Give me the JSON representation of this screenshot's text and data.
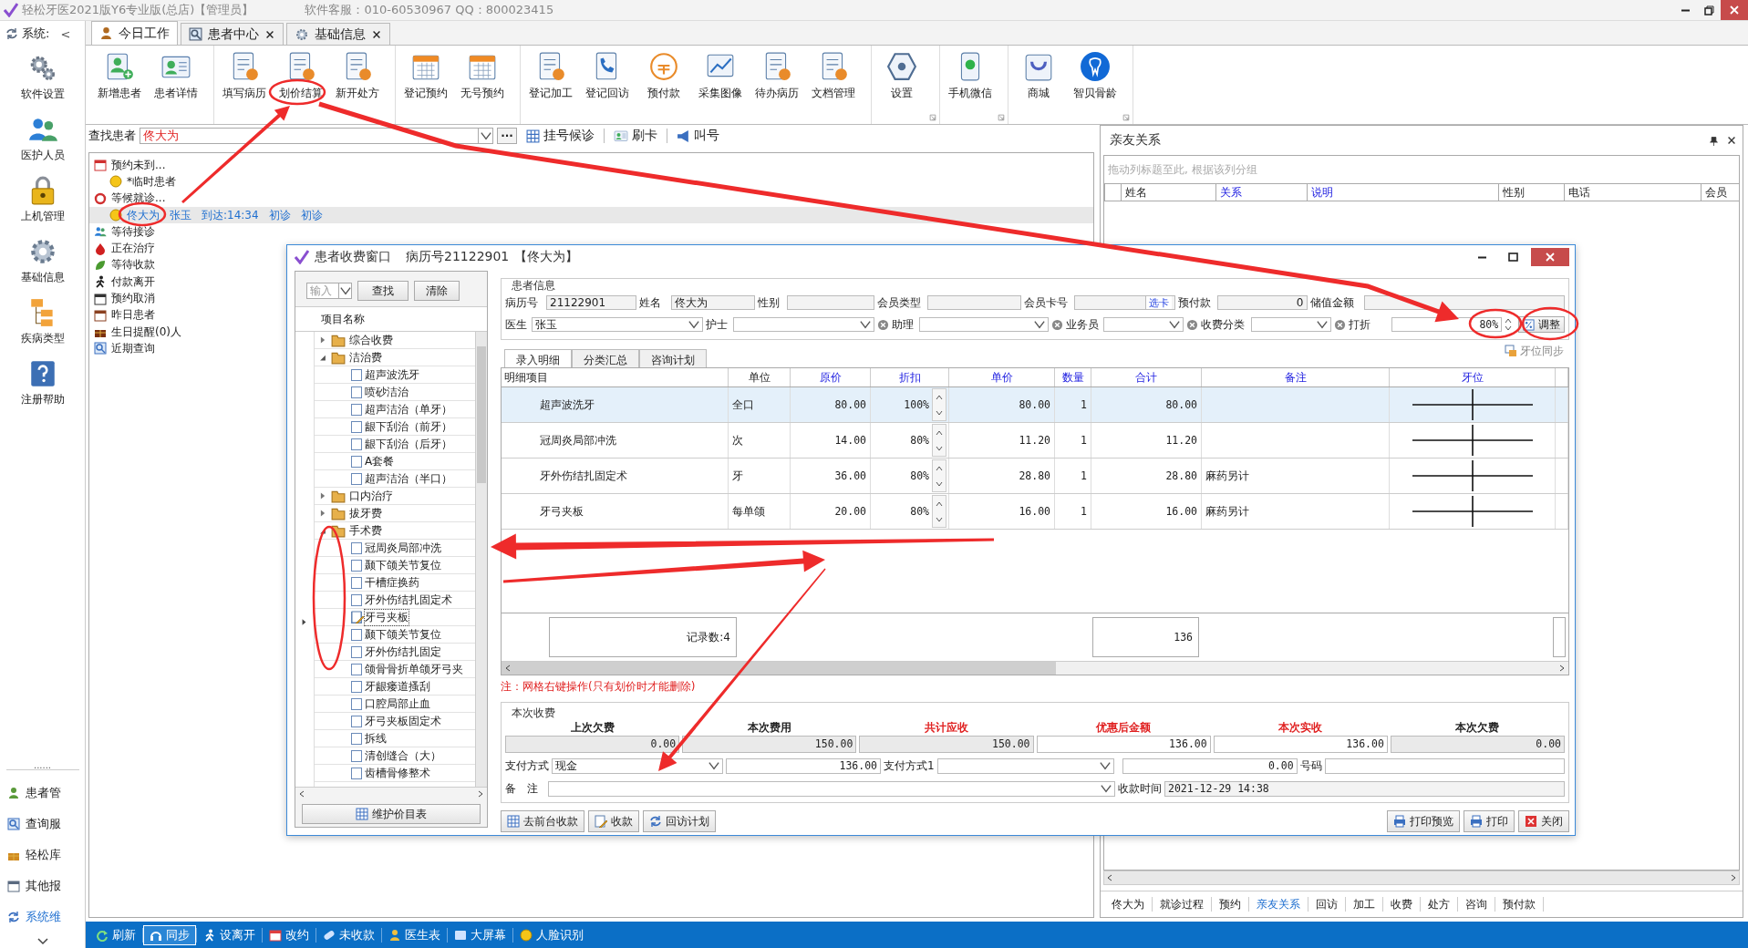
{
  "title_bar": {
    "title": "轻松牙医2021版Y6专业版(总店)【管理员】",
    "service": "软件客服：010-60530967 QQ：800023415"
  },
  "side_nav": {
    "header": "系统:",
    "collapse": "<",
    "items": [
      {
        "label": "软件设置"
      },
      {
        "label": "医护人员"
      },
      {
        "label": "上机管理"
      },
      {
        "label": "基础信息"
      },
      {
        "label": "疾病类型"
      },
      {
        "label": "注册帮助"
      }
    ],
    "divider": "......",
    "modules": [
      {
        "label": "患者管",
        "selected": false
      },
      {
        "label": "查询服",
        "selected": false
      },
      {
        "label": "轻松库",
        "selected": false
      },
      {
        "label": "其他报",
        "selected": false
      },
      {
        "label": "系统维",
        "selected": true
      }
    ]
  },
  "tabs": [
    {
      "label": "今日工作",
      "selected": true,
      "close": false
    },
    {
      "label": "患者中心",
      "selected": false,
      "close": true
    },
    {
      "label": "基础信息",
      "selected": false,
      "close": true
    }
  ],
  "ribbon": {
    "groups": [
      {
        "launcher": false,
        "buttons": [
          {
            "label": "新增患者"
          },
          {
            "label": "患者详情"
          }
        ]
      },
      {
        "launcher": false,
        "buttons": [
          {
            "label": "填写病历"
          },
          {
            "label": "划价结算"
          },
          {
            "label": "新开处方"
          }
        ]
      },
      {
        "launcher": false,
        "buttons": [
          {
            "label": "登记预约"
          },
          {
            "label": "无号预约"
          }
        ]
      },
      {
        "launcher": false,
        "buttons": [
          {
            "label": "登记加工"
          },
          {
            "label": "登记回访"
          },
          {
            "label": "预付款"
          },
          {
            "label": "采集图像"
          },
          {
            "label": "待办病历"
          },
          {
            "label": "文档管理"
          }
        ]
      },
      {
        "launcher": true,
        "buttons": [
          {
            "label": "设置"
          }
        ]
      },
      {
        "launcher": true,
        "buttons": [
          {
            "label": "手机微信"
          }
        ]
      },
      {
        "launcher": true,
        "buttons": [
          {
            "label": "商城"
          },
          {
            "label": "智贝骨龄"
          }
        ]
      }
    ]
  },
  "search": {
    "label": "查找患者",
    "value": "佟大为",
    "more": "···",
    "actions": [
      {
        "label": "挂号候诊"
      },
      {
        "label": "刷卡"
      },
      {
        "label": "叫号"
      }
    ]
  },
  "patient_list": {
    "items": [
      {
        "text": "预约未到...",
        "children": [
          {
            "cells": [
              "*临时患者"
            ],
            "selected": false
          }
        ]
      },
      {
        "text": "等候就诊...",
        "children": [
          {
            "cells": [
              "佟大为",
              "张玉",
              "到达:14:34",
              "初诊",
              "初诊"
            ],
            "selected": true
          }
        ]
      },
      {
        "text": "等待接诊"
      },
      {
        "text": "正在治疗"
      },
      {
        "text": "等待收款"
      },
      {
        "text": "付款离开"
      },
      {
        "text": "预约取消"
      },
      {
        "text": "昨日患者"
      },
      {
        "text": "生日提醒(0)人"
      },
      {
        "text": "近期查询"
      }
    ]
  },
  "relations_panel": {
    "title": "亲友关系",
    "group_hint": "拖动列标题至此, 根据该列分组",
    "columns": [
      {
        "label": "姓名",
        "highlight": false
      },
      {
        "label": "关系",
        "highlight": true
      },
      {
        "label": "说明",
        "highlight": true
      },
      {
        "label": "性别",
        "highlight": false
      },
      {
        "label": "电话",
        "highlight": false
      },
      {
        "label": "会员",
        "highlight": false
      }
    ],
    "tabs": [
      {
        "label": "佟大为",
        "selected": false
      },
      {
        "label": "就诊过程",
        "selected": false
      },
      {
        "label": "预约",
        "selected": false
      },
      {
        "label": "亲友关系",
        "selected": true
      },
      {
        "label": "回访",
        "selected": false
      },
      {
        "label": "加工",
        "selected": false
      },
      {
        "label": "收费",
        "selected": false
      },
      {
        "label": "处方",
        "selected": false
      },
      {
        "label": "咨询",
        "selected": false
      },
      {
        "label": "预付款",
        "selected": false
      }
    ]
  },
  "status_bar": [
    {
      "label": "刷新",
      "selected": false
    },
    {
      "label": "同步",
      "selected": true
    },
    {
      "label": "设离开",
      "selected": false
    },
    {
      "label": "改约",
      "selected": false
    },
    {
      "label": "未收款",
      "selected": false
    },
    {
      "label": "医生表",
      "selected": false
    },
    {
      "label": "大屏幕",
      "selected": false
    },
    {
      "label": "人脸识别",
      "selected": false
    }
  ],
  "charge_dialog": {
    "title": "患者收费窗口",
    "record": "病历号21122901",
    "patient": "【佟大为】",
    "search": {
      "placeholder": "输入",
      "find": "查找",
      "clear": "清除"
    },
    "tree_header": "项目名称",
    "tree": [
      {
        "label": "综合收费",
        "expanded": false
      },
      {
        "label": "洁治费",
        "expanded": true,
        "children": [
          {
            "label": "超声波洗牙",
            "checked": false,
            "current": false
          },
          {
            "label": "喷砂洁治",
            "checked": false,
            "current": false
          },
          {
            "label": "超声洁治（单牙）",
            "checked": false,
            "current": false
          },
          {
            "label": "龈下刮治（前牙）",
            "checked": false,
            "current": false
          },
          {
            "label": "龈下刮治（后牙）",
            "checked": false,
            "current": false
          },
          {
            "label": "A套餐",
            "checked": false,
            "current": false
          },
          {
            "label": "超声洁治（半口）",
            "checked": false,
            "current": false
          }
        ]
      },
      {
        "label": "口内治疗",
        "expanded": false
      },
      {
        "label": "拔牙费",
        "expanded": false
      },
      {
        "label": "手术费",
        "expanded": true,
        "children": [
          {
            "label": "冠周炎局部冲洗",
            "checked": false,
            "current": false
          },
          {
            "label": "颞下颌关节复位",
            "checked": false,
            "current": false
          },
          {
            "label": "干槽症换药",
            "checked": false,
            "current": false
          },
          {
            "label": "牙外伤结扎固定术",
            "checked": false,
            "current": false
          },
          {
            "label": "牙弓夹板",
            "checked": false,
            "current": true
          },
          {
            "label": "颞下颌关节复位",
            "checked": false,
            "current": false
          },
          {
            "label": "牙外伤结扎固定",
            "checked": false,
            "current": false
          },
          {
            "label": "颌骨骨折单颌牙弓夹",
            "checked": false,
            "current": false
          },
          {
            "label": "牙龈瘘道搔刮",
            "checked": false,
            "current": false
          },
          {
            "label": "口腔局部止血",
            "checked": false,
            "current": false
          },
          {
            "label": "牙弓夹板固定术",
            "checked": false,
            "current": false
          },
          {
            "label": "拆线",
            "checked": false,
            "current": false
          },
          {
            "label": "清创缝合（大）",
            "checked": false,
            "current": false
          },
          {
            "label": "齿槽骨修整术",
            "checked": false,
            "current": false
          }
        ]
      }
    ],
    "maintain_button": "维护价目表",
    "patient_info": {
      "title": "患者信息",
      "record_fields": [
        {
          "label": "病历号",
          "kind": "text",
          "value": "21122901"
        },
        {
          "label": "姓名",
          "kind": "text",
          "value": "佟大为"
        },
        {
          "label": "性别",
          "kind": "text"
        },
        {
          "label": "会员类型",
          "kind": "text"
        },
        {
          "label": "会员卡号",
          "kind": "card",
          "button": "选卡"
        },
        {
          "label": "预付款",
          "kind": "text",
          "value": "0"
        },
        {
          "label": "储值金额",
          "kind": "text"
        }
      ],
      "staff_fields": [
        {
          "label": "医生",
          "kind": "select",
          "value": "张玉",
          "clearable": false
        },
        {
          "label": "护士",
          "kind": "select",
          "clearable": true
        },
        {
          "label": "助理",
          "kind": "select",
          "clearable": true
        },
        {
          "label": "业务员",
          "kind": "select",
          "clearable": true
        },
        {
          "label": "收费分类",
          "kind": "select",
          "clearable": true
        },
        {
          "label": "打折",
          "kind": "spin",
          "value": "80%"
        }
      ],
      "adjust_button": "调整"
    },
    "sync_link": "牙位同步",
    "tabs": [
      {
        "label": "录入明细",
        "selected": true
      },
      {
        "label": "分类汇总",
        "selected": false
      },
      {
        "label": "咨询计划",
        "selected": false
      }
    ],
    "grid": {
      "columns": [
        {
          "label": "明细项目",
          "highlight": false
        },
        {
          "label": "单位",
          "highlight": false
        },
        {
          "label": "原价",
          "highlight": true
        },
        {
          "label": "折扣",
          "highlight": true
        },
        {
          "label": "单价",
          "highlight": true
        },
        {
          "label": "数量",
          "highlight": true
        },
        {
          "label": "合计",
          "highlight": true
        },
        {
          "label": "备注",
          "highlight": true
        },
        {
          "label": "牙位",
          "highlight": true
        }
      ],
      "rows": [
        {
          "item": "超声波洗牙",
          "unit": "全口",
          "price": "80.00",
          "discount": "100%",
          "unit_price": "80.00",
          "qty": "1",
          "total": "80.00",
          "selected": true
        },
        {
          "item": "冠周炎局部冲洗",
          "unit": "次",
          "price": "14.00",
          "discount": "80%",
          "unit_price": "11.20",
          "qty": "1",
          "total": "11.20",
          "selected": false
        },
        {
          "item": "牙外伤结扎固定术",
          "unit": "牙",
          "price": "36.00",
          "discount": "80%",
          "unit_price": "28.80",
          "qty": "1",
          "total": "28.80",
          "note": "麻药另计",
          "selected": false
        },
        {
          "item": "牙弓夹板",
          "unit": "每单颌",
          "price": "20.00",
          "discount": "80%",
          "unit_price": "16.00",
          "qty": "1",
          "total": "16.00",
          "note": "麻药另计",
          "selected": false
        }
      ],
      "footer": {
        "count": "记录数:4",
        "total": "136"
      }
    },
    "note": "注：网格右键操作(只有划价时才能删除)",
    "summary": {
      "title": "本次收费",
      "items": [
        {
          "label": "上次欠费",
          "emphasis": false,
          "value": "0.00",
          "editable": false
        },
        {
          "label": "本次费用",
          "emphasis": false,
          "value": "150.00",
          "editable": false
        },
        {
          "label": "共计应收",
          "emphasis": true,
          "value": "150.00",
          "editable": false
        },
        {
          "label": "优惠后金额",
          "emphasis": true,
          "value": "136.00",
          "editable": true
        },
        {
          "label": "本次实收",
          "emphasis": true,
          "value": "136.00",
          "editable": true
        },
        {
          "label": "本次欠费",
          "emphasis": false,
          "value": "0.00",
          "editable": false
        }
      ]
    },
    "payment": {
      "method_label": "支付方式",
      "method": "现金",
      "amount": "136.00",
      "method2_label": "支付方式1",
      "amount2": "0.00",
      "number_label": "号码"
    },
    "remark": {
      "label": "备　注",
      "time_label": "收款时间",
      "time": "2021-12-29 14:38"
    },
    "buttons_left": [
      {
        "label": "去前台收款"
      },
      {
        "label": "收款"
      },
      {
        "label": "回访计划"
      }
    ],
    "buttons_right": [
      {
        "label": "打印预览"
      },
      {
        "label": "打印"
      },
      {
        "label": "关闭"
      }
    ]
  }
}
